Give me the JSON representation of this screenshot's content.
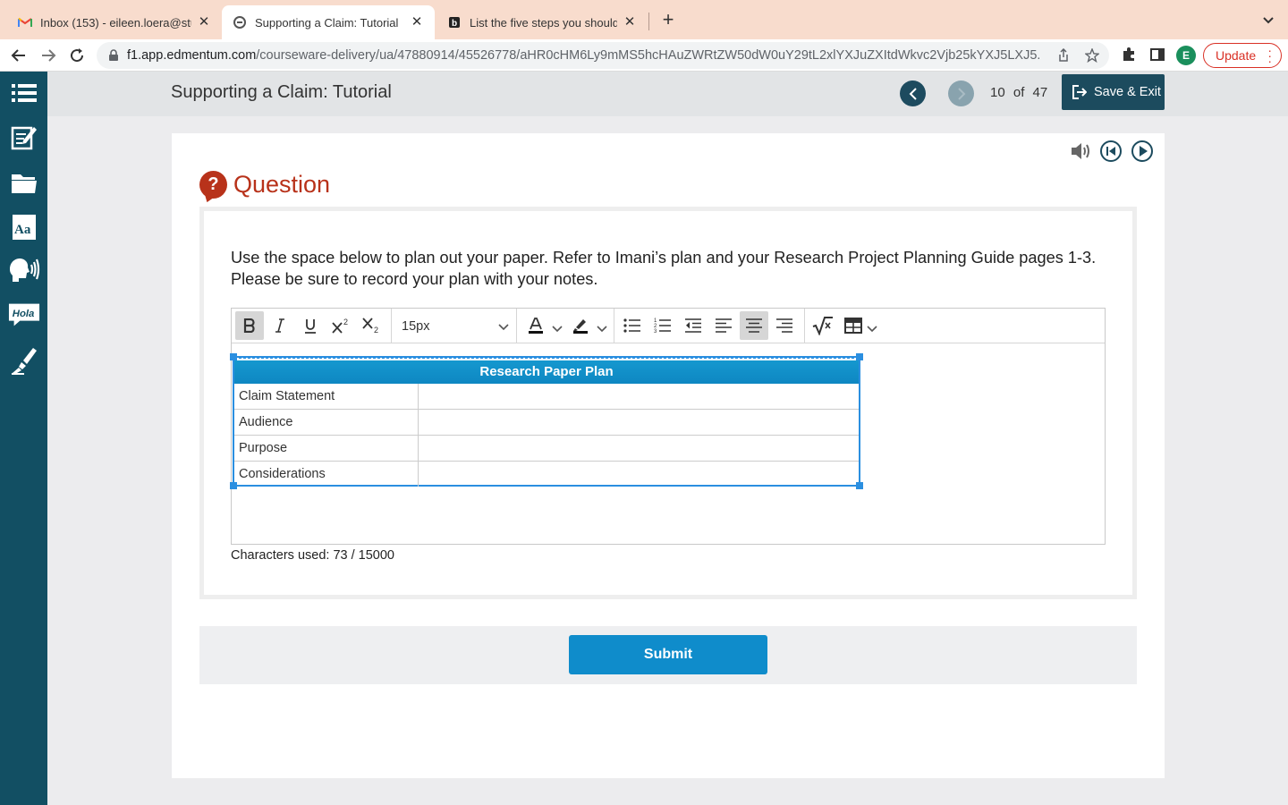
{
  "browser": {
    "tabs": [
      {
        "title": "Inbox (153) - eileen.loera@stud",
        "icon": "gmail-icon",
        "active": false
      },
      {
        "title": "Supporting a Claim: Tutorial",
        "icon": "edmentum-icon",
        "active": true
      },
      {
        "title": "List the five steps you should t",
        "icon": "brainly-icon",
        "active": false
      }
    ],
    "url_host": "f1.app.edmentum.com",
    "url_path": "/courseware-delivery/ua/47880914/45526778/aHR0cHM6Ly9mMS5hcHAuZWRtZW50dW0uY29tL2xlYXJuZXItdWkvc2Vjb25kYXJ5LXJ5...",
    "profile_initial": "E",
    "update_label": "Update"
  },
  "app": {
    "title": "Supporting a Claim: Tutorial",
    "pager": {
      "current": "10",
      "of": "of",
      "total": "47"
    },
    "save_exit_label": "Save & Exit",
    "sidebar_icons": [
      "menu-list-icon",
      "notes-icon",
      "folder-icon",
      "dictionary-icon",
      "text-to-speech-icon",
      "translate-icon",
      "highlighter-icon"
    ],
    "sidebar_translate_text": "Hola"
  },
  "question": {
    "heading": "Question",
    "badge": "?",
    "prompt": "Use the space below to plan out your paper. Refer to Imani’s plan and your Research Project Planning Guide pages 1-3. Please be sure to record your plan with your notes.",
    "editor": {
      "font_size": "15px",
      "toolbar": [
        "bold",
        "italic",
        "underline",
        "superscript",
        "subscript",
        "font-size",
        "font-color",
        "highlight-color",
        "bulleted-list",
        "numbered-list",
        "outdent",
        "align-left",
        "align-center",
        "align-right",
        "equation",
        "table"
      ]
    },
    "table": {
      "title": "Research Paper Plan",
      "rows": [
        {
          "label": "Claim Statement",
          "value": ""
        },
        {
          "label": "Audience",
          "value": ""
        },
        {
          "label": "Purpose",
          "value": ""
        },
        {
          "label": "Considerations",
          "value": ""
        }
      ]
    },
    "char_count": "Characters used: 73 / 15000",
    "submit_label": "Submit"
  },
  "colors": {
    "accent": "#0f8ccb",
    "sidebar": "#124f63",
    "question_red": "#b8321a",
    "tab_strip": "#f8dccd"
  }
}
